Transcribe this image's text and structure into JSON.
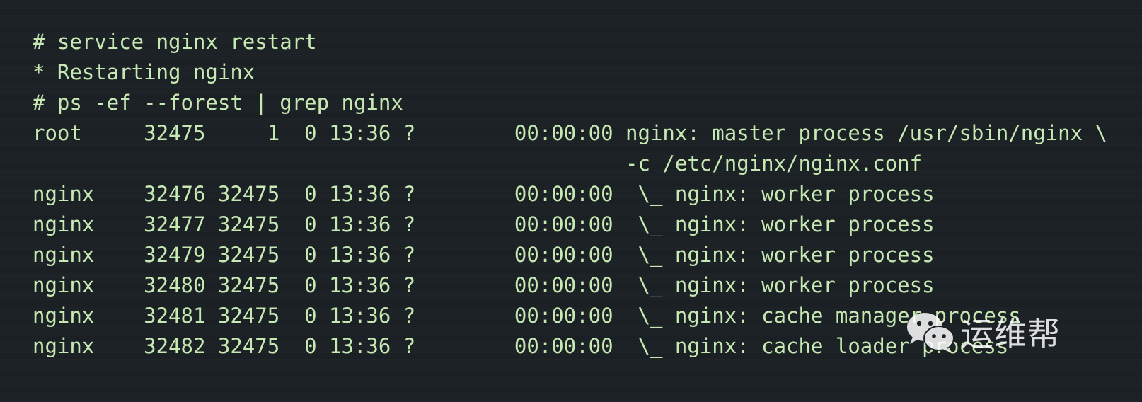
{
  "terminal": {
    "lines": [
      "# service nginx restart",
      "* Restarting nginx",
      "# ps -ef --forest | grep nginx",
      "root     32475     1  0 13:36 ?        00:00:00 nginx: master process /usr/sbin/nginx \\",
      "                                                -c /etc/nginx/nginx.conf",
      "nginx    32476 32475  0 13:36 ?        00:00:00  \\_ nginx: worker process",
      "nginx    32477 32475  0 13:36 ?        00:00:00  \\_ nginx: worker process",
      "nginx    32479 32475  0 13:36 ?        00:00:00  \\_ nginx: worker process",
      "nginx    32480 32475  0 13:36 ?        00:00:00  \\_ nginx: worker process",
      "nginx    32481 32475  0 13:36 ?        00:00:00  \\_ nginx: cache manager process",
      "nginx    32482 32475  0 13:36 ?        00:00:00  \\_ nginx: cache loader process"
    ]
  },
  "watermark": {
    "text": "运维帮",
    "icon": "wechat-icon"
  }
}
